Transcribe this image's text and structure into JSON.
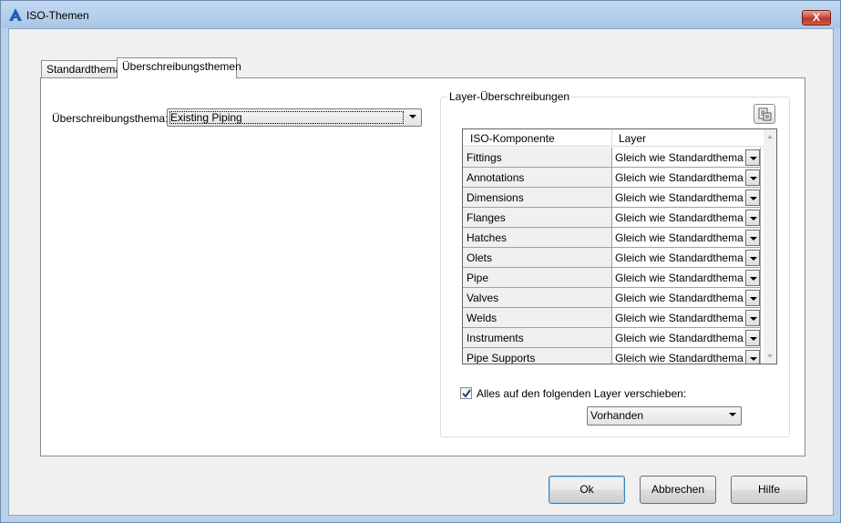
{
  "window": {
    "title": "ISO-Themen",
    "close_glyph": "X"
  },
  "tabs": [
    {
      "label": "Standardthema",
      "active": false
    },
    {
      "label": "Überschreibungsthemen",
      "active": true
    }
  ],
  "override_theme": {
    "label": "Überschreibungsthema:",
    "value": "Existing Piping"
  },
  "layer_overrides": {
    "group_title": "Layer-Überschreibungen",
    "icon": "table-settings-icon",
    "columns": [
      "ISO-Komponente",
      "Layer"
    ],
    "rows": [
      {
        "component": "Fittings",
        "layer": "Gleich wie Standardthema"
      },
      {
        "component": "Annotations",
        "layer": "Gleich wie Standardthema"
      },
      {
        "component": "Dimensions",
        "layer": "Gleich wie Standardthema"
      },
      {
        "component": "Flanges",
        "layer": "Gleich wie Standardthema"
      },
      {
        "component": "Hatches",
        "layer": "Gleich wie Standardthema"
      },
      {
        "component": "Olets",
        "layer": "Gleich wie Standardthema"
      },
      {
        "component": "Pipe",
        "layer": "Gleich wie Standardthema"
      },
      {
        "component": "Valves",
        "layer": "Gleich wie Standardthema"
      },
      {
        "component": "Welds",
        "layer": "Gleich wie Standardthema"
      },
      {
        "component": "Instruments",
        "layer": "Gleich wie Standardthema"
      },
      {
        "component": "Pipe Supports",
        "layer": "Gleich wie Standardthema"
      }
    ],
    "move_all": {
      "checked": true,
      "label": "Alles auf den folgenden Layer verschieben:"
    },
    "target_layer": "Vorhanden"
  },
  "buttons": {
    "ok": "Ok",
    "cancel": "Abbrechen",
    "help": "Hilfe"
  },
  "colors": {
    "accent": "#3c7fb1",
    "close": "#c75050"
  }
}
